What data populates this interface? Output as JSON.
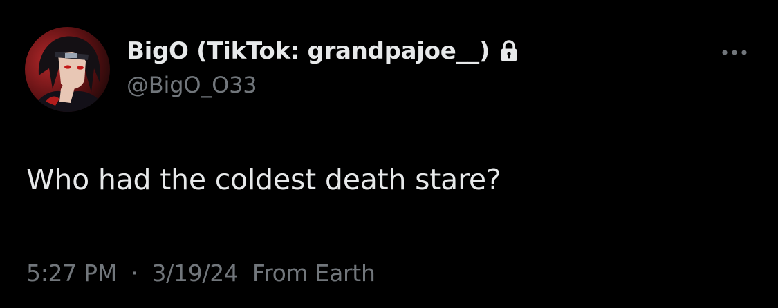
{
  "author": {
    "display_name": "BigO (TikTok: grandpajoe__)",
    "handle": "@BigO_O33",
    "protected_icon": "lock-icon",
    "avatar_icon": "anime-character-avatar"
  },
  "tweet": {
    "text": "Who had the coldest death stare?",
    "time": "5:27 PM",
    "separator": "·",
    "date": "3/19/24",
    "source": "From Earth"
  },
  "actions": {
    "more_icon": "more-horizontal-icon"
  },
  "colors": {
    "background": "#000000",
    "primary_text": "#e7e9ea",
    "secondary_text": "#71767b"
  }
}
